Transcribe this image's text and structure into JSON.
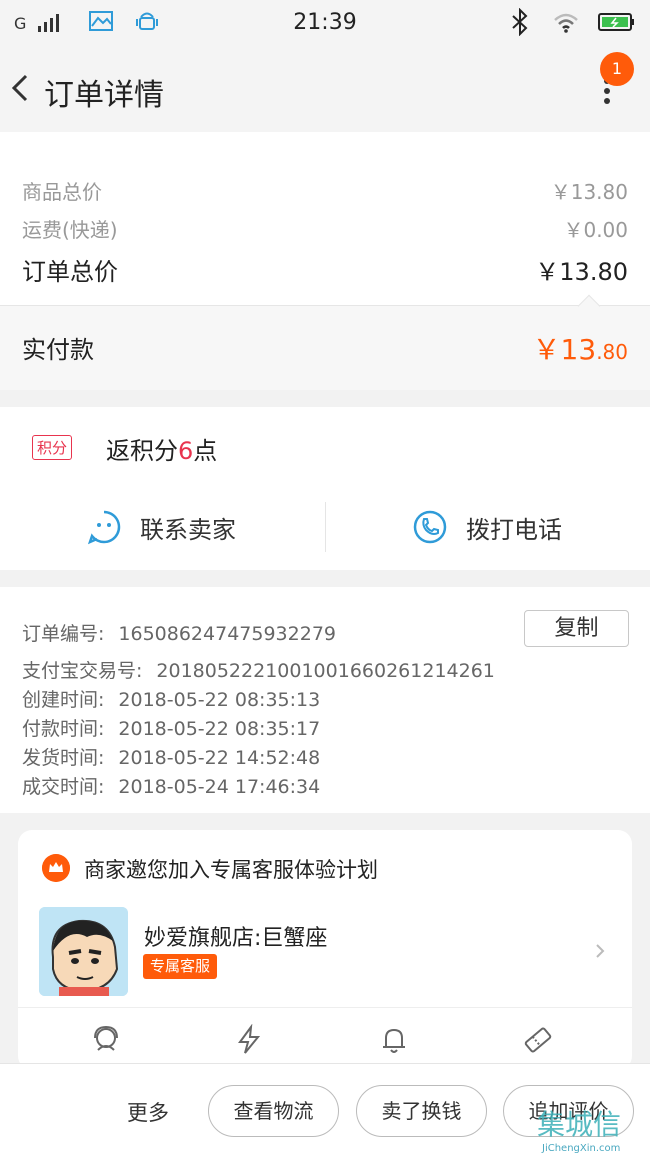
{
  "status_bar": {
    "network": "G",
    "time": "21:39"
  },
  "nav": {
    "title": "订单详情",
    "badge": "1"
  },
  "price": {
    "goods_label": "商品总价",
    "goods_value": "￥13.80",
    "shipping_label": "运费(快递)",
    "shipping_value": "￥0.00",
    "total_label": "订单总价",
    "total_value": "￥13.80",
    "paid_label": "实付款",
    "paid_prefix": "￥13",
    "paid_decimal": ".80"
  },
  "points": {
    "tag": "积分",
    "text_before": "返积分",
    "number": "6",
    "text_after": "点"
  },
  "contact": {
    "seller": "联系卖家",
    "phone": "拨打电话"
  },
  "order_info": {
    "copy_button": "复制",
    "lines": [
      {
        "key": "订单编号:",
        "value": "165086247475932279"
      },
      {
        "key": "支付宝交易号:",
        "value": "2018052221001001660261214261"
      },
      {
        "key": "创建时间:",
        "value": "2018-05-22 08:35:13"
      },
      {
        "key": "付款时间:",
        "value": "2018-05-22 08:35:17"
      },
      {
        "key": "发货时间:",
        "value": "2018-05-22 14:52:48"
      },
      {
        "key": "成交时间:",
        "value": "2018-05-24 17:46:34"
      }
    ]
  },
  "service": {
    "title": "商家邀您加入专属客服体验计划",
    "shop_name": "妙爱旗舰店:巨蟹座",
    "tag": "专属客服",
    "icons": [
      "headset-icon",
      "lightning-icon",
      "bell-icon",
      "ticket-icon"
    ]
  },
  "bottom": {
    "more": "更多",
    "buttons": [
      "查看物流",
      "卖了换钱",
      "追加评价"
    ]
  },
  "watermark": {
    "main": "集城信",
    "sub": "JiChengXin.com"
  },
  "colors": {
    "accent": "#ff5b0a",
    "points": "#e8344e",
    "icon_blue": "#2f9bd8"
  }
}
